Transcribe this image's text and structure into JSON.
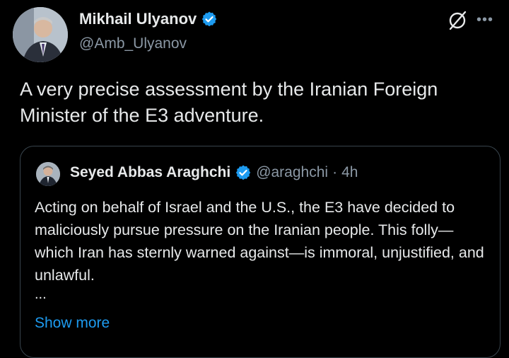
{
  "author": {
    "name": "Mikhail Ulyanov",
    "handle": "@Amb_Ulyanov"
  },
  "tweet": {
    "text": "A very precise assessment by the Iranian Foreign Minister of the E3 adventure."
  },
  "quoted": {
    "name": "Seyed Abbas Araghchi",
    "handle": "@araghchi",
    "separator": "·",
    "time": "4h",
    "text": "Acting on behalf of Israel and the U.S., the E3 have decided to maliciously pursue pressure on the Iranian people. This folly—which Iran has sternly warned against—is immoral, unjustified, and unlawful.",
    "ellipsis": "...",
    "show_more": "Show more"
  },
  "icons": {
    "verified": "verified-badge-icon",
    "grok": "grok-icon",
    "more": "more-options-icon"
  },
  "colors": {
    "background": "#000000",
    "text": "#e7e9ea",
    "secondary": "#8b98a5",
    "link": "#1d9bf0",
    "verified": "#1d9bf0"
  }
}
